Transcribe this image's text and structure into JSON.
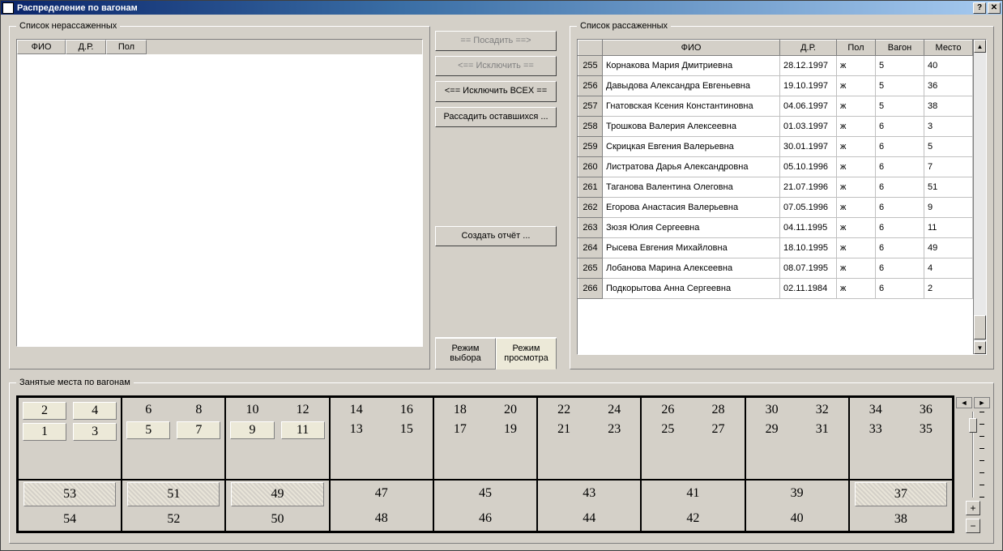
{
  "title": "Распределение по вагонам",
  "groups": {
    "unseated": "Список нерассаженных",
    "seated": "Список рассаженных",
    "wagon": "Занятые места по вагонам"
  },
  "unseated_headers": {
    "fio": "ФИО",
    "dr": "Д.Р.",
    "pol": "Пол"
  },
  "buttons": {
    "seat": "== Посадить ==>",
    "exclude": "<== Исключить ==",
    "exclude_all": "<== Исключить ВСЕХ ==",
    "seat_rest": "Рассадить оставшихся ...",
    "report": "Создать отчёт ..."
  },
  "modes": {
    "select": "Режим выбора",
    "view": "Режим просмотра"
  },
  "seated_headers": {
    "idx": "",
    "fio": "ФИО",
    "dr": "Д.Р.",
    "pol": "Пол",
    "wagon": "Вагон",
    "seat": "Место"
  },
  "seated_rows": [
    {
      "idx": "255",
      "fio": "Корнакова Мария Дмитриевна",
      "dr": "28.12.1997",
      "pol": "ж",
      "wagon": "5",
      "seat": "40"
    },
    {
      "idx": "256",
      "fio": "Давыдова Александра Евгеньевна",
      "dr": "19.10.1997",
      "pol": "ж",
      "wagon": "5",
      "seat": "36"
    },
    {
      "idx": "257",
      "fio": "Гнатовская Ксения Константиновна",
      "dr": "04.06.1997",
      "pol": "ж",
      "wagon": "5",
      "seat": "38"
    },
    {
      "idx": "258",
      "fio": "Трошкова Валерия Алексеевна",
      "dr": "01.03.1997",
      "pol": "ж",
      "wagon": "6",
      "seat": "3"
    },
    {
      "idx": "259",
      "fio": "Скрицкая Евгения Валерьевна",
      "dr": "30.01.1997",
      "pol": "ж",
      "wagon": "6",
      "seat": "5"
    },
    {
      "idx": "260",
      "fio": "Листратова Дарья Александровна",
      "dr": "05.10.1996",
      "pol": "ж",
      "wagon": "6",
      "seat": "7"
    },
    {
      "idx": "261",
      "fio": "Таганова Валентина Олеговна",
      "dr": "21.07.1996",
      "pol": "ж",
      "wagon": "6",
      "seat": "51"
    },
    {
      "idx": "262",
      "fio": "Егорова Анастасия Валерьевна",
      "dr": "07.05.1996",
      "pol": "ж",
      "wagon": "6",
      "seat": "9"
    },
    {
      "idx": "263",
      "fio": "Зюзя Юлия Сергеевна",
      "dr": "04.11.1995",
      "pol": "ж",
      "wagon": "6",
      "seat": "11"
    },
    {
      "idx": "264",
      "fio": "Рысева Евгения Михайловна",
      "dr": "18.10.1995",
      "pol": "ж",
      "wagon": "6",
      "seat": "49"
    },
    {
      "idx": "265",
      "fio": "Лобанова Марина Алексеевна",
      "dr": "08.07.1995",
      "pol": "ж",
      "wagon": "6",
      "seat": "4"
    },
    {
      "idx": "266",
      "fio": "Подкорытова Анна Сергеевна",
      "dr": "02.11.1984",
      "pol": "ж",
      "wagon": "6",
      "seat": "2"
    }
  ],
  "wagon": {
    "compartments": [
      {
        "top": [
          "2",
          "4"
        ],
        "bot": [
          "1",
          "3"
        ],
        "top_raised": true,
        "bot_raised": true
      },
      {
        "top": [
          "6",
          "8"
        ],
        "bot": [
          "5",
          "7"
        ],
        "bot_raised": true
      },
      {
        "top": [
          "10",
          "12"
        ],
        "bot": [
          "9",
          "11"
        ],
        "bot_raised": true
      },
      {
        "top": [
          "14",
          "16"
        ],
        "bot": [
          "13",
          "15"
        ]
      },
      {
        "top": [
          "18",
          "20"
        ],
        "bot": [
          "17",
          "19"
        ]
      },
      {
        "top": [
          "22",
          "24"
        ],
        "bot": [
          "21",
          "23"
        ]
      },
      {
        "top": [
          "26",
          "28"
        ],
        "bot": [
          "25",
          "27"
        ]
      },
      {
        "top": [
          "30",
          "32"
        ],
        "bot": [
          "29",
          "31"
        ]
      },
      {
        "top": [
          "34",
          "36"
        ],
        "bot": [
          "33",
          "35"
        ]
      }
    ],
    "side": [
      {
        "top": "53",
        "bot": "54",
        "top_occ": true
      },
      {
        "top": "51",
        "bot": "52",
        "top_occ": true
      },
      {
        "top": "49",
        "bot": "50",
        "top_occ": true
      },
      {
        "top": "47",
        "bot": "48"
      },
      {
        "top": "45",
        "bot": "46"
      },
      {
        "top": "43",
        "bot": "44"
      },
      {
        "top": "41",
        "bot": "42"
      },
      {
        "top": "39",
        "bot": "40"
      },
      {
        "top": "37",
        "bot": "38",
        "top_occ": true
      }
    ]
  }
}
